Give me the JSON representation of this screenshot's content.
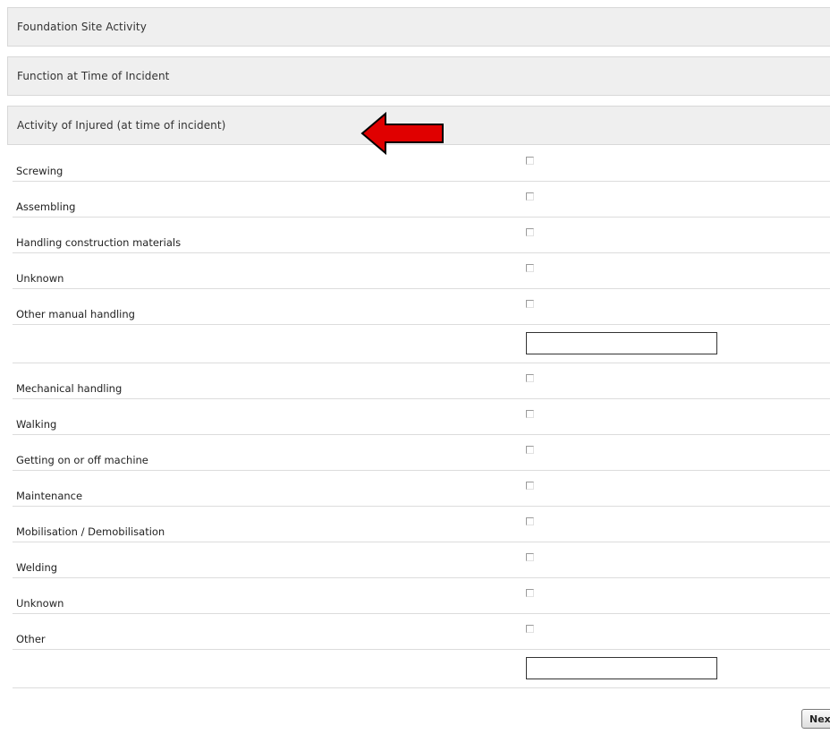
{
  "sections": {
    "foundation_site_activity": "Foundation Site Activity",
    "function_at_time": "Function at Time of Incident",
    "activity_of_injured": "Activity of Injured (at time of incident)"
  },
  "activities": [
    {
      "label": "Screwing",
      "checked": false
    },
    {
      "label": "Assembling",
      "checked": false
    },
    {
      "label": "Handling construction materials",
      "checked": false
    },
    {
      "label": "Unknown",
      "checked": false
    },
    {
      "label": "Other manual handling",
      "checked": false
    },
    {
      "label": "Mechanical handling",
      "checked": false
    },
    {
      "label": "Walking",
      "checked": false
    },
    {
      "label": "Getting on or off machine",
      "checked": false
    },
    {
      "label": "Maintenance",
      "checked": false
    },
    {
      "label": "Mobilisation / Demobilisation",
      "checked": false
    },
    {
      "label": "Welding",
      "checked": false
    },
    {
      "label": "Unknown",
      "checked": false
    },
    {
      "label": "Other",
      "checked": false
    }
  ],
  "other_manual_handling_text": "",
  "other_text": "",
  "next_button_label": "Next",
  "colors": {
    "arrow_fill": "#e00000",
    "header_bg": "#efefef"
  },
  "icons": {
    "annotation": "left-arrow-icon"
  }
}
